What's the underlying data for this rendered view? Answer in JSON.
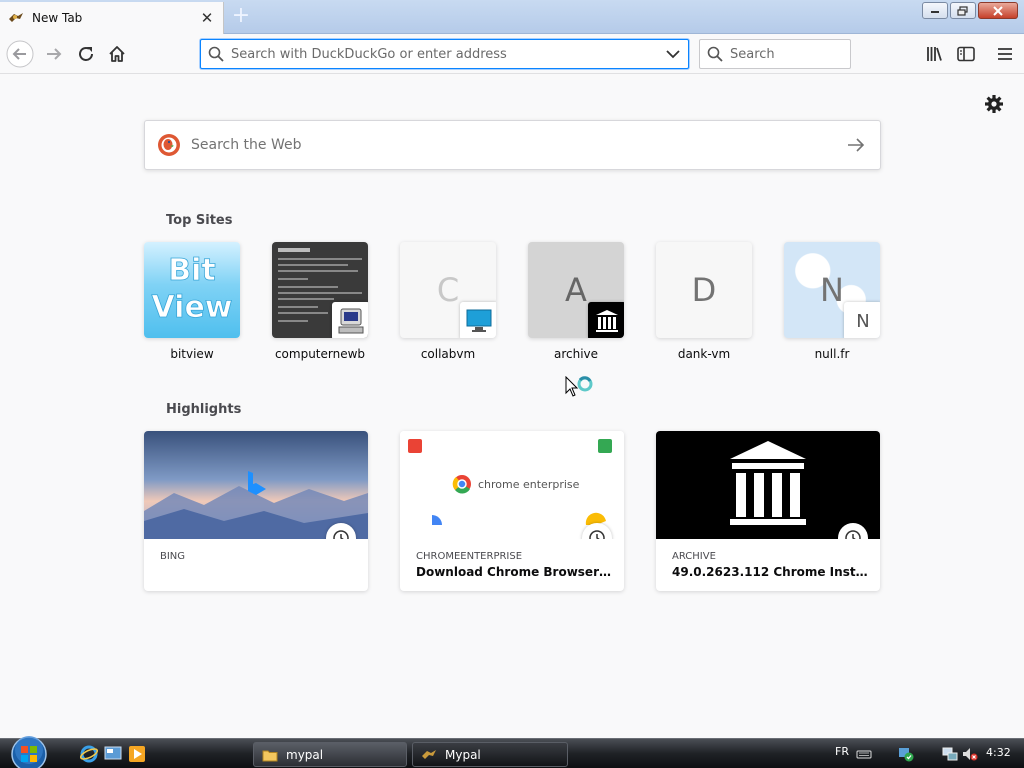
{
  "tab": {
    "title": "New Tab"
  },
  "urlbar": {
    "placeholder": "Search with DuckDuckGo or enter address"
  },
  "searchbar": {
    "placeholder": "Search"
  },
  "web_search": {
    "placeholder": "Search the Web"
  },
  "top_sites": {
    "title": "Top Sites",
    "items": [
      {
        "label": "bitview",
        "letter": ""
      },
      {
        "label": "computernewb",
        "letter": ""
      },
      {
        "label": "collabvm",
        "letter": "C"
      },
      {
        "label": "archive",
        "letter": "A"
      },
      {
        "label": "dank-vm",
        "letter": "D"
      },
      {
        "label": "null.fr",
        "letter": "N"
      }
    ],
    "bitview_logo": [
      "Bit",
      "View"
    ],
    "nullfr_icon_letter": "N"
  },
  "highlights": {
    "title": "Highlights",
    "items": [
      {
        "host": "BING",
        "title": ""
      },
      {
        "host": "CHROMEENTERPRISE",
        "title": "Download Chrome Browser for ...",
        "image_text": "chrome enterprise"
      },
      {
        "host": "ARCHIVE",
        "title": "49.0.2623.112 Chrome Installer :..."
      }
    ]
  },
  "taskbar": {
    "items": [
      {
        "label": "mypal"
      },
      {
        "label": "Mypal"
      }
    ],
    "language": "FR",
    "time": "4:32"
  },
  "colors": {
    "accent": "#0a84ff",
    "duckduckgo": "#de5833"
  },
  "icons": [
    "back-icon",
    "forward-icon",
    "reload-icon",
    "home-icon",
    "library-icon",
    "sidebar-icon",
    "menu-icon",
    "gear-icon",
    "clock-icon"
  ]
}
